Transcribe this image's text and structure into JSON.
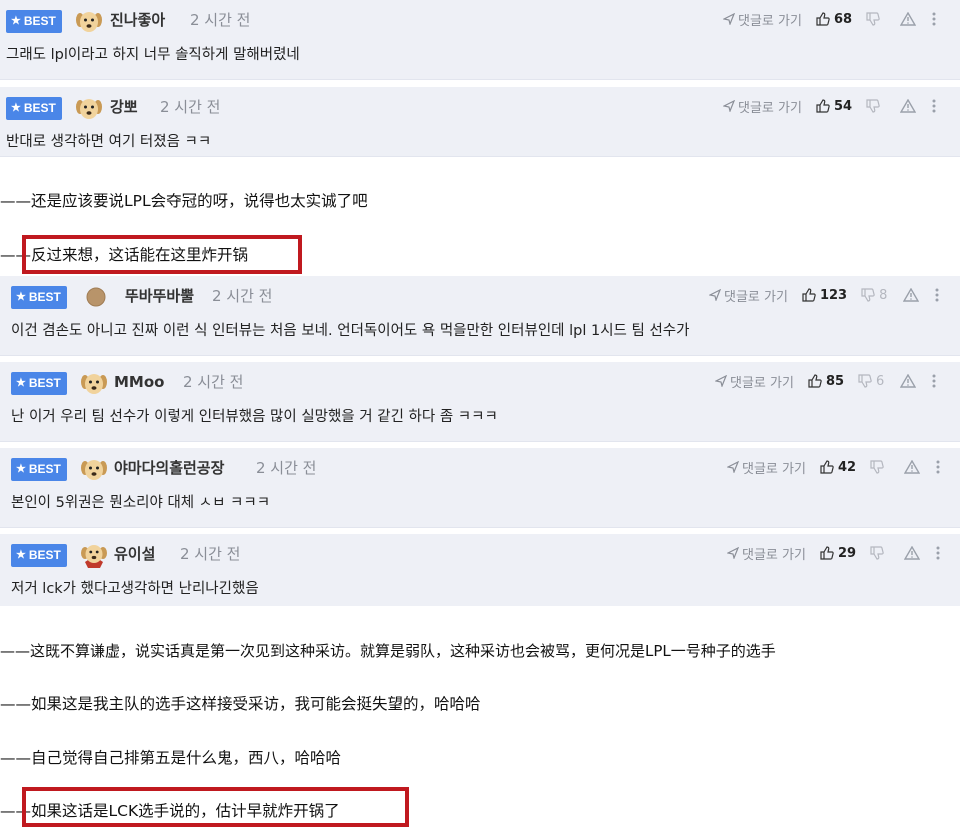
{
  "badge_label": "BEST",
  "reply_label": "댓글로 가기",
  "comments": [
    {
      "nick": "진나좋아",
      "time": "2 시간 전",
      "text": "그래도 lpl이라고 하지 너무 솔직하게 말해버렸네",
      "likes": "68",
      "dislikes": "",
      "avatar": "dog-face"
    },
    {
      "nick": "강뽀",
      "time": "2 시간 전",
      "text": "반대로 생각하면 여기 터졌음 ㅋㅋ",
      "likes": "54",
      "dislikes": "",
      "avatar": "dog-face"
    },
    {
      "nick": "뚜바뚜바뿔",
      "time": "2 시간 전",
      "text": "이건 겸손도 아니고 진짜 이런 식 인터뷰는 처음 보네. 언더독이어도 욕 먹을만한 인터뷰인데 lpl 1시드 팀 선수가",
      "likes": "123",
      "dislikes": "8",
      "avatar": "brown-circle"
    },
    {
      "nick": "MMoo",
      "time": "2 시간 전",
      "text": "난 이거 우리 팀 선수가 이렇게 인터뷰했음 많이 실망했을 거 같긴 하다 좀 ㅋㅋㅋ",
      "likes": "85",
      "dislikes": "6",
      "avatar": "dog-face"
    },
    {
      "nick": "야마다의홀런공장",
      "time": "2 시간 전",
      "text": "본인이 5위권은 뭔소리야 대체 ㅅㅂ ㅋㅋㅋ",
      "likes": "42",
      "dislikes": "",
      "avatar": "dog-face"
    },
    {
      "nick": "유이설",
      "time": "2 시간 전",
      "text": "저거 lck가 했다고생각하면 난리나긴했음",
      "likes": "29",
      "dislikes": "",
      "avatar": "dog-cape"
    }
  ],
  "translations": [
    "——还是应该要说LPL会夺冠的呀，说得也太实诚了吧",
    "——反过来想，这话能在这里炸开锅",
    "——这既不算谦虚，说实话真是第一次见到这种采访。就算是弱队，这种采访也会被骂，更何况是LPL一号种子的选手",
    "——如果这是我主队的选手这样接受采访，我可能会挺失望的，哈哈哈",
    "——自己觉得自己排第五是什么鬼，西八，哈哈哈",
    "——如果这话是LCK选手说的，估计早就炸开锅了"
  ],
  "colors": {
    "badge": "#4a86e8",
    "highlight": "#c0191f",
    "comment_bg": "#eef0f6"
  }
}
